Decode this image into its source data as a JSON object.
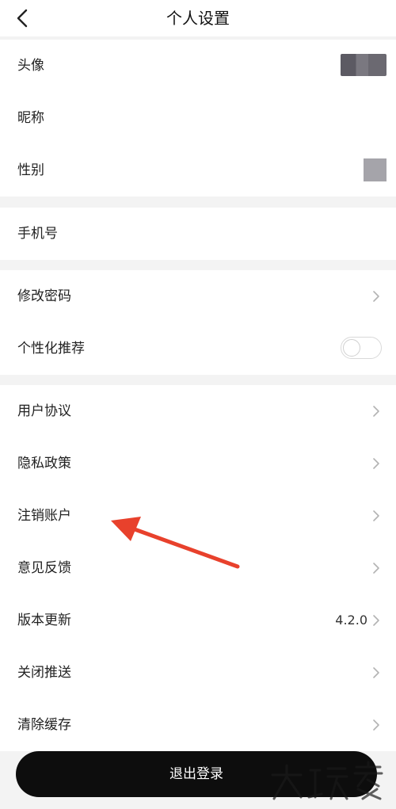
{
  "header": {
    "title": "个人设置"
  },
  "profile": [
    {
      "label": "头像"
    },
    {
      "label": "昵称"
    },
    {
      "label": "性别"
    }
  ],
  "phone": {
    "label": "手机号"
  },
  "security": {
    "password_label": "修改密码",
    "personalize_label": "个性化推荐",
    "personalize_enabled": false
  },
  "about": [
    {
      "label": "用户协议"
    },
    {
      "label": "隐私政策"
    },
    {
      "label": "注销账户"
    },
    {
      "label": "意见反馈"
    },
    {
      "label": "版本更新",
      "value": "4.2.0"
    },
    {
      "label": "关闭推送"
    },
    {
      "label": "清除缓存"
    }
  ],
  "logout_label": "退出登录",
  "colors": {
    "background": "#f3f3f3",
    "card": "#ffffff",
    "logout_button": "#0d0d0d",
    "annotation_arrow": "#e8412c"
  },
  "icons": {
    "back": "chevron-left-icon",
    "row_arrow": "chevron-right-icon"
  }
}
